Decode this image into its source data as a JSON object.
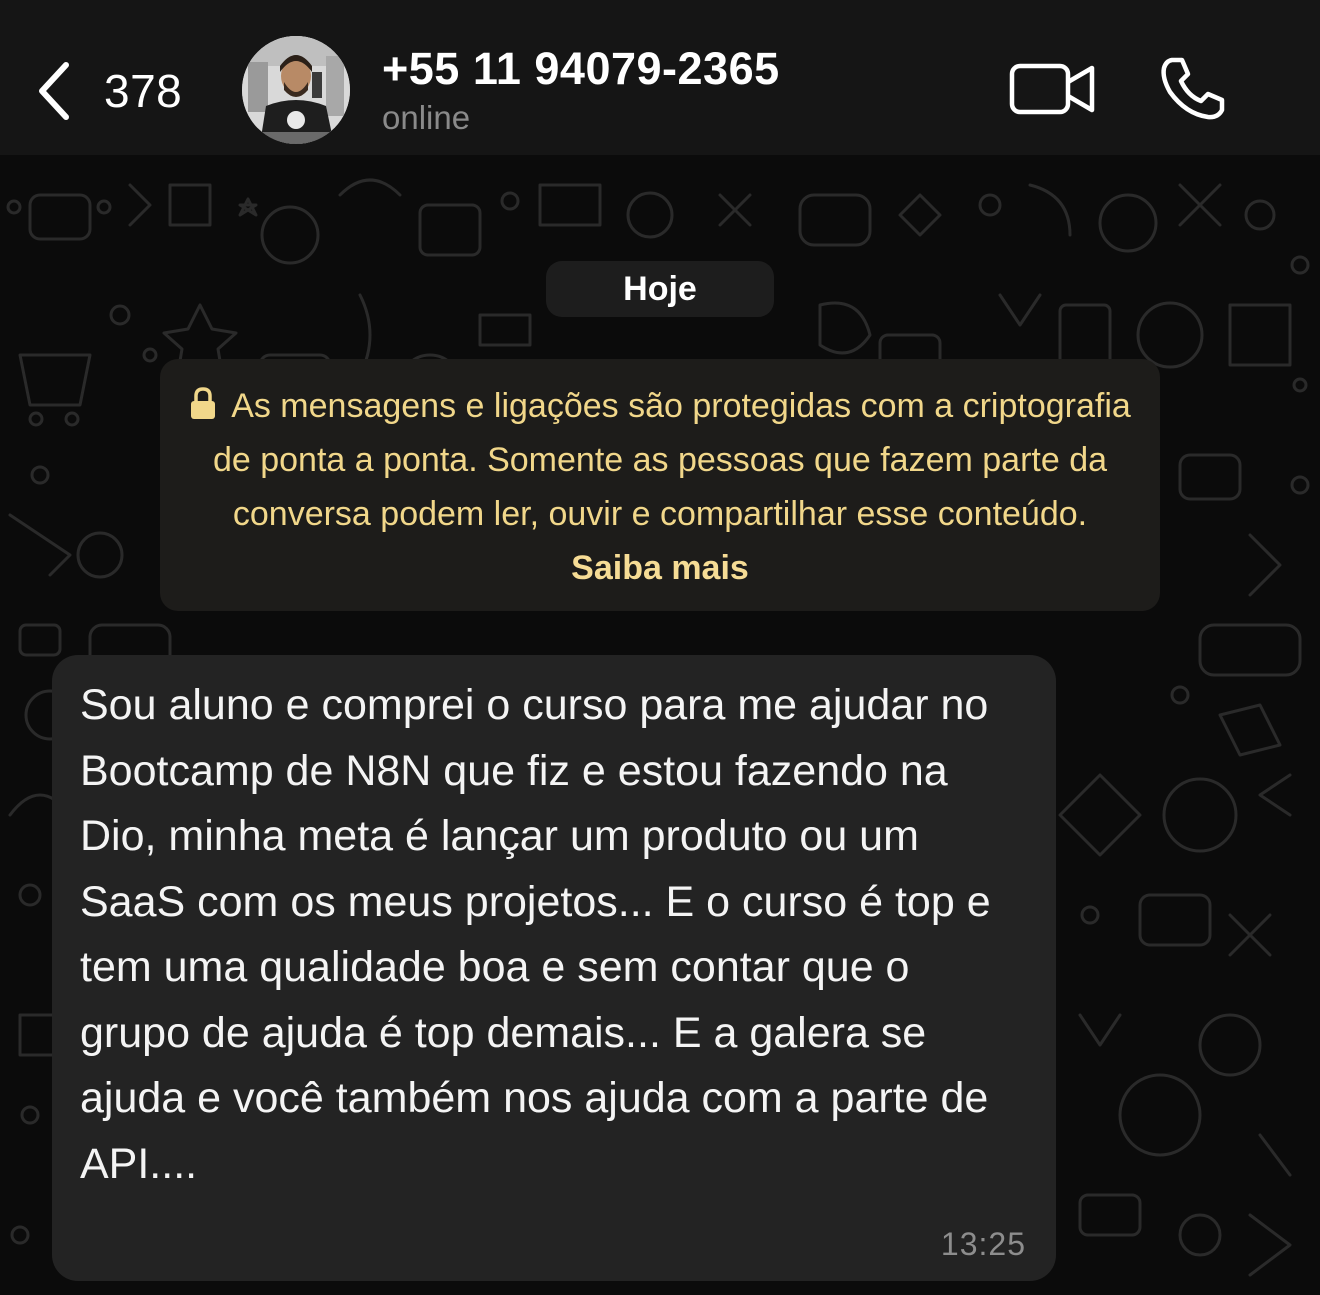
{
  "header": {
    "back_count": "378",
    "contact_name": "+55 11 94079-2365",
    "status": "online",
    "icons": {
      "back": "chevron-left-icon",
      "video": "video-camera-icon",
      "call": "phone-icon"
    }
  },
  "chat": {
    "date_label": "Hoje",
    "encryption_notice": {
      "text": "As mensagens e ligações são protegidas com a criptografia de ponta a ponta. Somente as pessoas que fazem parte da conversa podem ler, ouvir e compartilhar esse conteúdo.",
      "link": "Saiba mais",
      "icon": "lock-icon"
    },
    "messages": [
      {
        "text": "Sou aluno e comprei o curso para me ajudar no Bootcamp de N8N que fiz e estou fazendo na Dio, minha meta é lançar um produto ou um SaaS com os meus projetos... E o curso é top e tem uma qualidade boa e sem contar que o grupo de ajuda é top demais... E a galera se ajuda e você também nos ajuda com a parte de API....",
        "time": "13:25"
      }
    ]
  },
  "colors": {
    "header_bg": "#151515",
    "chat_bg": "#0b0b0b",
    "bubble_bg": "#232323",
    "notice_text": "#f1d78a"
  }
}
